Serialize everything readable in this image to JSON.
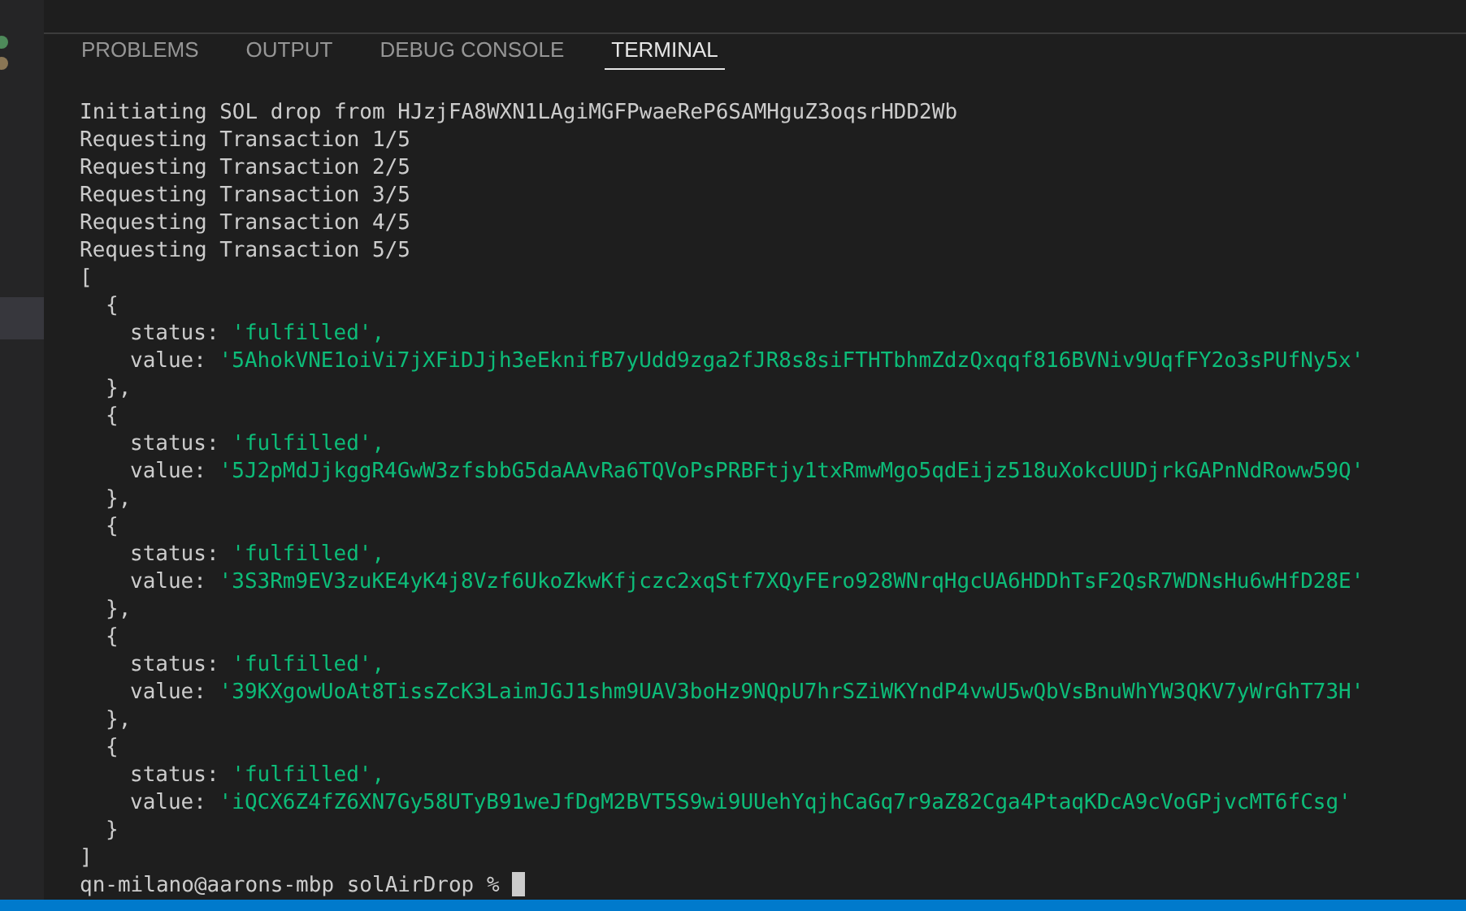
{
  "panel_tabs": [
    {
      "label": "PROBLEMS",
      "selected": false
    },
    {
      "label": "OUTPUT",
      "selected": false
    },
    {
      "label": "DEBUG CONSOLE",
      "selected": false
    },
    {
      "label": "TERMINAL",
      "selected": true
    }
  ],
  "terminal": {
    "log_lines": [
      "Initiating SOL drop from HJzjFA8WXN1LAgiMGFPwaeReP6SAMHguZ3oqsrHDD2Wb",
      "Requesting Transaction 1/5",
      "Requesting Transaction 2/5",
      "Requesting Transaction 3/5",
      "Requesting Transaction 4/5",
      "Requesting Transaction 5/5"
    ],
    "result": {
      "open": "[",
      "close": "]",
      "items": [
        {
          "open": "{",
          "status_key": "status:",
          "status": "'fulfilled',",
          "value_key": "value:",
          "value": "'5AhokVNE1oiVi7jXFiDJjh3eEknifB7yUdd9zga2fJR8s8siFTHTbhmZdzQxqqf816BVNiv9UqfFY2o3sPUfNy5x'",
          "close": "},"
        },
        {
          "open": "{",
          "status_key": "status:",
          "status": "'fulfilled',",
          "value_key": "value:",
          "value": "'5J2pMdJjkggR4GwW3zfsbbG5daAAvRa6TQVoPsPRBFtjy1txRmwMgo5qdEijz518uXokcUUDjrkGAPnNdRoww59Q'",
          "close": "},"
        },
        {
          "open": "{",
          "status_key": "status:",
          "status": "'fulfilled',",
          "value_key": "value:",
          "value": "'3S3Rm9EV3zuKE4yK4j8Vzf6UkoZkwKfjczc2xqStf7XQyFEro928WNrqHgcUA6HDDhTsF2QsR7WDNsHu6wHfD28E'",
          "close": "},"
        },
        {
          "open": "{",
          "status_key": "status:",
          "status": "'fulfilled',",
          "value_key": "value:",
          "value": "'39KXgowUoAt8TissZcK3LaimJGJ1shm9UAV3boHz9NQpU7hrSZiWKYndP4vwU5wQbVsBnuWhYW3QKV7yWrGhT73H'",
          "close": "},"
        },
        {
          "open": "{",
          "status_key": "status:",
          "status": "'fulfilled',",
          "value_key": "value:",
          "value": "'iQCX6Z4fZ6XN7Gy58UTyB91weJfDgM2BVT5S9wi9UUehYqjhCaGq7r9aZ82Cga4PtaqKDcA9cVoGPjvcMT6fCsg'",
          "close": "}"
        }
      ]
    },
    "prompt": "qn-milano@aarons-mbp solAirDrop %"
  }
}
